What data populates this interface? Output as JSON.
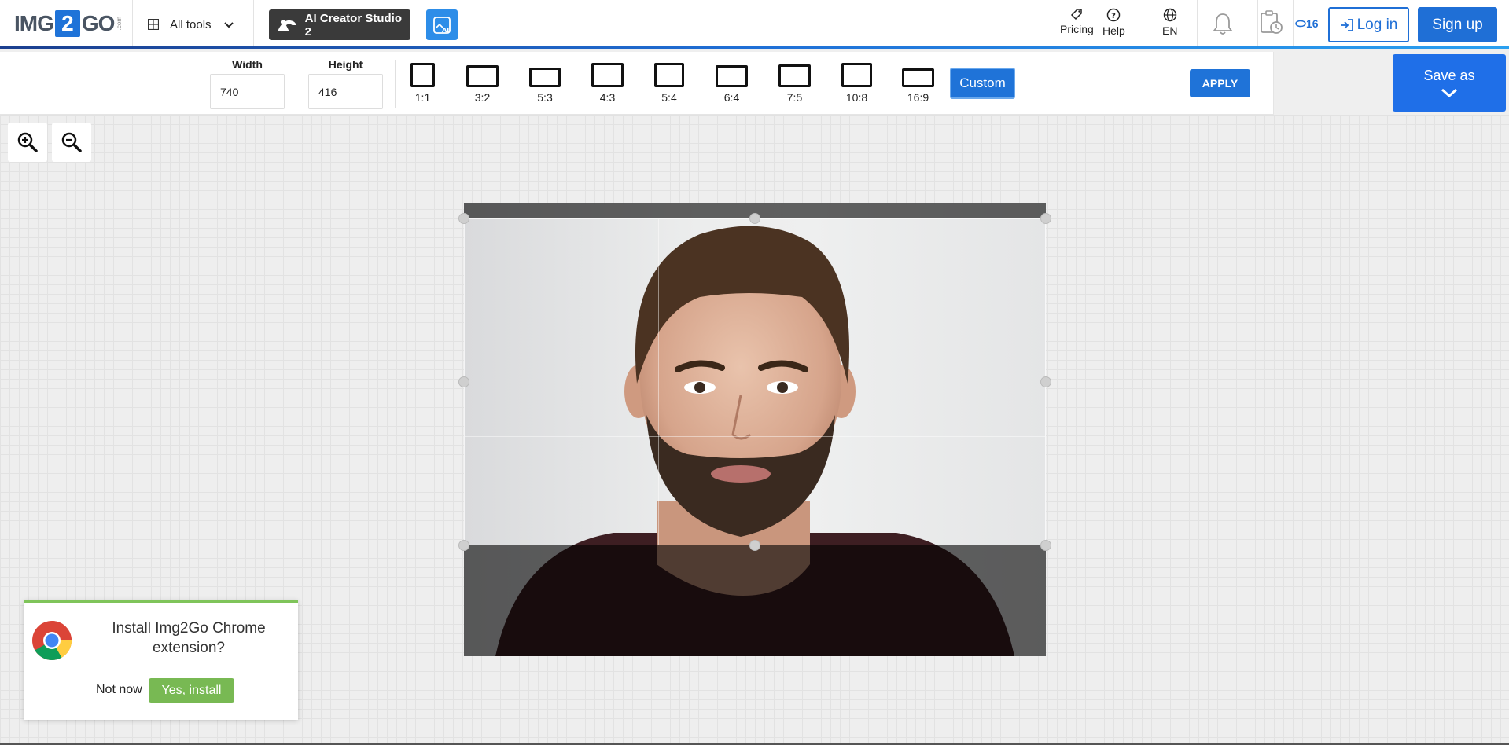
{
  "header": {
    "logo": {
      "left": "IMG",
      "mid": "2",
      "right": "GO",
      "suffix": ".com"
    },
    "all_tools_label": "All tools",
    "ai_studio_label": "AI Creator Studio 2",
    "pricing_label": "Pricing",
    "help_label": "Help",
    "language_label": "EN",
    "credits_label": "16",
    "login_label": "Log in",
    "signup_label": "Sign up",
    "icons": [
      "grid-icon",
      "chevron-down-icon",
      "ai-studio-icon",
      "ai-image-icon",
      "tag-icon",
      "help-icon",
      "globe-icon",
      "bell-icon",
      "history-icon",
      "credits-icon",
      "login-icon"
    ]
  },
  "toolbar": {
    "width_label": "Width",
    "width_value": "740",
    "height_label": "Height",
    "height_value": "416",
    "ratios": [
      "1:1",
      "3:2",
      "5:3",
      "4:3",
      "5:4",
      "6:4",
      "7:5",
      "10:8",
      "16:9"
    ],
    "custom_label": "Custom",
    "apply_label": "APPLY",
    "save_as_label": "Save as"
  },
  "popup": {
    "message": "Install Img2Go Chrome extension?",
    "not_now_label": "Not now",
    "yes_install_label": "Yes, install"
  },
  "colors": {
    "brand_blue": "#1f6fd6",
    "ai_studio_bg": "#3a3a3a",
    "install_green": "#78b953"
  }
}
